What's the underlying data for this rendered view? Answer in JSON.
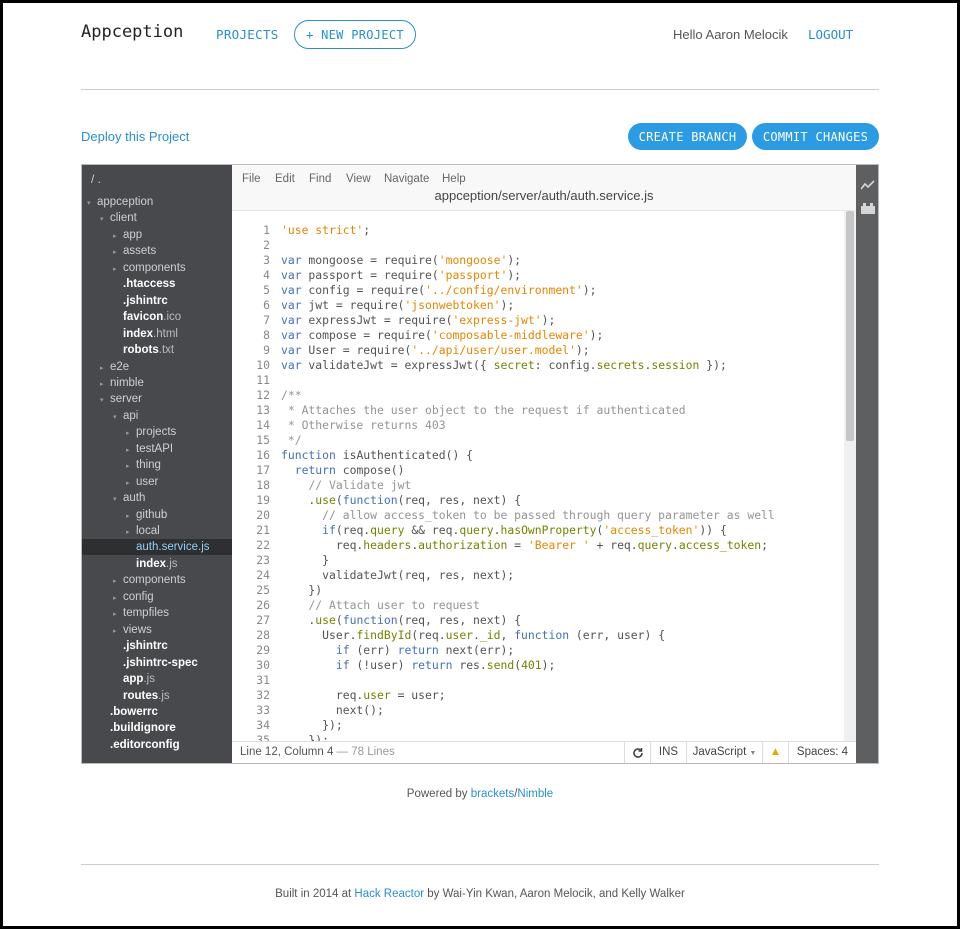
{
  "header": {
    "brand": "Appception",
    "projects_label": "PROJECTS",
    "new_project_label": "+ NEW PROJECT",
    "greeting": "Hello Aaron Melocik",
    "logout_label": "LOGOUT"
  },
  "toolbar": {
    "deploy_label": "Deploy this Project",
    "create_branch_label": "CREATE BRANCH",
    "commit_label": "COMMIT CHANGES"
  },
  "sidebar": {
    "root": "/ .",
    "items": [
      {
        "label": "appception",
        "kind": "dir",
        "depth": 0,
        "open": true
      },
      {
        "label": "client",
        "kind": "dir",
        "depth": 1,
        "open": true
      },
      {
        "label": "app",
        "kind": "dir",
        "depth": 2
      },
      {
        "label": "assets",
        "kind": "dir",
        "depth": 2
      },
      {
        "label": "components",
        "kind": "dir",
        "depth": 2
      },
      {
        "name": ".htaccess",
        "ext": "",
        "kind": "file",
        "depth": 2
      },
      {
        "name": ".jshintrc",
        "ext": "",
        "kind": "file",
        "depth": 2
      },
      {
        "name": "favicon",
        "ext": ".ico",
        "kind": "file",
        "depth": 2
      },
      {
        "name": "index",
        "ext": ".html",
        "kind": "file",
        "depth": 2
      },
      {
        "name": "robots",
        "ext": ".txt",
        "kind": "file",
        "depth": 2
      },
      {
        "label": "e2e",
        "kind": "dir",
        "depth": 1
      },
      {
        "label": "nimble",
        "kind": "dir",
        "depth": 1
      },
      {
        "label": "server",
        "kind": "dir",
        "depth": 1,
        "open": true
      },
      {
        "label": "api",
        "kind": "dir",
        "depth": 2,
        "open": true
      },
      {
        "label": "projects",
        "kind": "dir",
        "depth": 3
      },
      {
        "label": "testAPI",
        "kind": "dir",
        "depth": 3
      },
      {
        "label": "thing",
        "kind": "dir",
        "depth": 3
      },
      {
        "label": "user",
        "kind": "dir",
        "depth": 3
      },
      {
        "label": "auth",
        "kind": "dir",
        "depth": 2,
        "open": true
      },
      {
        "label": "github",
        "kind": "dir",
        "depth": 3
      },
      {
        "label": "local",
        "kind": "dir",
        "depth": 3
      },
      {
        "name": "auth.service",
        "ext": ".js",
        "kind": "file",
        "depth": 3,
        "selected": true
      },
      {
        "name": "index",
        "ext": ".js",
        "kind": "file",
        "depth": 3
      },
      {
        "label": "components",
        "kind": "dir",
        "depth": 2
      },
      {
        "label": "config",
        "kind": "dir",
        "depth": 2
      },
      {
        "label": "tempfiles",
        "kind": "dir",
        "depth": 2
      },
      {
        "label": "views",
        "kind": "dir",
        "depth": 2
      },
      {
        "name": ".jshintrc",
        "ext": "",
        "kind": "file",
        "depth": 2
      },
      {
        "name": ".jshintrc-spec",
        "ext": "",
        "kind": "file",
        "depth": 2
      },
      {
        "name": "app",
        "ext": ".js",
        "kind": "file",
        "depth": 2
      },
      {
        "name": "routes",
        "ext": ".js",
        "kind": "file",
        "depth": 2
      },
      {
        "name": ".bowerrc",
        "ext": "",
        "kind": "file",
        "depth": 1
      },
      {
        "name": ".buildignore",
        "ext": "",
        "kind": "file",
        "depth": 1
      },
      {
        "name": ".editorconfig",
        "ext": "",
        "kind": "file",
        "depth": 1
      }
    ]
  },
  "editor": {
    "menu": [
      "File",
      "Edit",
      "Find",
      "View",
      "Navigate",
      "Help"
    ],
    "filepath": "appception/server/auth/auth.service.js",
    "lines": [
      [
        [
          "str",
          "'use strict'"
        ],
        [
          "t",
          ";"
        ]
      ],
      [],
      [
        [
          "kw",
          "var"
        ],
        [
          "t",
          " mongoose = require("
        ],
        [
          "str",
          "'mongoose'"
        ],
        [
          "t",
          ");"
        ]
      ],
      [
        [
          "kw",
          "var"
        ],
        [
          "t",
          " passport = require("
        ],
        [
          "str",
          "'passport'"
        ],
        [
          "t",
          ");"
        ]
      ],
      [
        [
          "kw",
          "var"
        ],
        [
          "t",
          " config = require("
        ],
        [
          "str",
          "'../config/environment'"
        ],
        [
          "t",
          ");"
        ]
      ],
      [
        [
          "kw",
          "var"
        ],
        [
          "t",
          " jwt = require("
        ],
        [
          "str",
          "'jsonwebtoken'"
        ],
        [
          "t",
          ");"
        ]
      ],
      [
        [
          "kw",
          "var"
        ],
        [
          "t",
          " expressJwt = require("
        ],
        [
          "str",
          "'express-jwt'"
        ],
        [
          "t",
          ");"
        ]
      ],
      [
        [
          "kw",
          "var"
        ],
        [
          "t",
          " compose = require("
        ],
        [
          "str",
          "'composable-middleware'"
        ],
        [
          "t",
          ");"
        ]
      ],
      [
        [
          "kw",
          "var"
        ],
        [
          "t",
          " User = require("
        ],
        [
          "str",
          "'../api/user/user.model'"
        ],
        [
          "t",
          ");"
        ]
      ],
      [
        [
          "kw",
          "var"
        ],
        [
          "t",
          " validateJwt = expressJwt({ "
        ],
        [
          "prop",
          "secret"
        ],
        [
          "t",
          ": config."
        ],
        [
          "prop",
          "secrets"
        ],
        [
          "t",
          "."
        ],
        [
          "prop",
          "session"
        ],
        [
          "t",
          " });"
        ]
      ],
      [],
      [
        [
          "cm",
          "/**"
        ]
      ],
      [
        [
          "cm",
          " * Attaches the user object to the request if authenticated"
        ]
      ],
      [
        [
          "cm",
          " * Otherwise returns 403"
        ]
      ],
      [
        [
          "cm",
          " */"
        ]
      ],
      [
        [
          "kw",
          "function"
        ],
        [
          "t",
          " isAuthenticated() {"
        ]
      ],
      [
        [
          "t",
          "  "
        ],
        [
          "kw",
          "return"
        ],
        [
          "t",
          " compose()"
        ]
      ],
      [
        [
          "t",
          "    "
        ],
        [
          "cm",
          "// Validate jwt"
        ]
      ],
      [
        [
          "t",
          "    ."
        ],
        [
          "prop",
          "use"
        ],
        [
          "t",
          "("
        ],
        [
          "kw",
          "function"
        ],
        [
          "t",
          "(req, res, next) {"
        ]
      ],
      [
        [
          "t",
          "      "
        ],
        [
          "cm",
          "// allow access_token to be passed through query parameter as well"
        ]
      ],
      [
        [
          "t",
          "      "
        ],
        [
          "kw",
          "if"
        ],
        [
          "t",
          "(req."
        ],
        [
          "prop",
          "query"
        ],
        [
          "t",
          " && req."
        ],
        [
          "prop",
          "query"
        ],
        [
          "t",
          "."
        ],
        [
          "prop",
          "hasOwnProperty"
        ],
        [
          "t",
          "("
        ],
        [
          "str",
          "'access_token'"
        ],
        [
          "t",
          ")) {"
        ]
      ],
      [
        [
          "t",
          "        req."
        ],
        [
          "prop",
          "headers"
        ],
        [
          "t",
          "."
        ],
        [
          "prop",
          "authorization"
        ],
        [
          "t",
          " = "
        ],
        [
          "str",
          "'Bearer '"
        ],
        [
          "t",
          " + req."
        ],
        [
          "prop",
          "query"
        ],
        [
          "t",
          "."
        ],
        [
          "prop",
          "access_token"
        ],
        [
          "t",
          ";"
        ]
      ],
      [
        [
          "t",
          "      }"
        ]
      ],
      [
        [
          "t",
          "      validateJwt(req, res, next);"
        ]
      ],
      [
        [
          "t",
          "    })"
        ]
      ],
      [
        [
          "t",
          "    "
        ],
        [
          "cm",
          "// Attach user to request"
        ]
      ],
      [
        [
          "t",
          "    ."
        ],
        [
          "prop",
          "use"
        ],
        [
          "t",
          "("
        ],
        [
          "kw",
          "function"
        ],
        [
          "t",
          "(req, res, next) {"
        ]
      ],
      [
        [
          "t",
          "      User."
        ],
        [
          "prop",
          "findById"
        ],
        [
          "t",
          "(req."
        ],
        [
          "prop",
          "user"
        ],
        [
          "t",
          "."
        ],
        [
          "prop",
          "_id"
        ],
        [
          "t",
          ", "
        ],
        [
          "kw",
          "function"
        ],
        [
          "t",
          " (err, user) {"
        ]
      ],
      [
        [
          "t",
          "        "
        ],
        [
          "kw",
          "if"
        ],
        [
          "t",
          " (err) "
        ],
        [
          "kw",
          "return"
        ],
        [
          "t",
          " next(err);"
        ]
      ],
      [
        [
          "t",
          "        "
        ],
        [
          "kw",
          "if"
        ],
        [
          "t",
          " (!user) "
        ],
        [
          "kw",
          "return"
        ],
        [
          "t",
          " res."
        ],
        [
          "prop",
          "send"
        ],
        [
          "t",
          "("
        ],
        [
          "num",
          "401"
        ],
        [
          "t",
          ");"
        ]
      ],
      [],
      [
        [
          "t",
          "        req."
        ],
        [
          "prop",
          "user"
        ],
        [
          "t",
          " = user;"
        ]
      ],
      [
        [
          "t",
          "        next();"
        ]
      ],
      [
        [
          "t",
          "      });"
        ]
      ],
      [
        [
          "t",
          "    });"
        ]
      ]
    ],
    "status": {
      "position": "Line 12, Column 4",
      "dash": " — ",
      "line_count": "78 Lines",
      "mode": "INS",
      "language": "JavaScript",
      "spaces": "Spaces: 4"
    },
    "scroll_fraction": 0.0
  },
  "footer": {
    "powered_prefix": "Powered by ",
    "brackets": "brackets",
    "slash": "/",
    "nimble": "Nimble",
    "built_prefix": "Built in 2014 at ",
    "hack_reactor": "Hack Reactor",
    "built_suffix": " by Wai-Yin Kwan, Aaron Melocik, and Kelly Walker"
  }
}
